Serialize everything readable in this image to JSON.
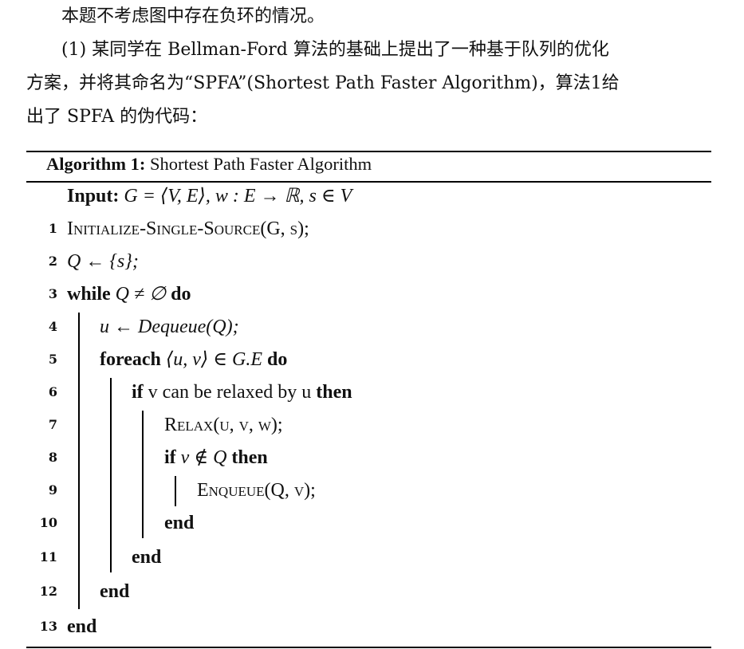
{
  "intro": {
    "line1": "本题不考虑图中存在负环的情况。",
    "line2": "(1) 某同学在 Bellman-Ford 算法的基础上提出了一种基于队列的优化",
    "line3": "方案，并将其命名为“SPFA”(Shortest Path Faster Algorithm)，算法1给",
    "line4": "出了 SPFA 的伪代码："
  },
  "algorithm": {
    "label": "Algorithm 1:",
    "title": "Shortest Path Faster Algorithm",
    "input_label": "Input:",
    "input_value": "G = ⟨V, E⟩, w : E → ℝ, s ∈ V",
    "lines": [
      {
        "no": "1",
        "text": "Initialize-Single-Source(G, s);"
      },
      {
        "no": "2",
        "text": "Q ← {s};"
      },
      {
        "no": "3",
        "kw1": "while",
        "text": " Q ≠ ∅ ",
        "kw2": "do"
      },
      {
        "no": "4",
        "text": "u ← Dequeue(Q);"
      },
      {
        "no": "5",
        "kw1": "foreach",
        "text": " ⟨u, v⟩ ∈ G.E ",
        "kw2": "do"
      },
      {
        "no": "6",
        "kw1": "if",
        "text": " v can be relaxed by u ",
        "kw2": "then"
      },
      {
        "no": "7",
        "text": "Relax(u, v, w);"
      },
      {
        "no": "8",
        "kw1": "if",
        "text": " v ∉ Q ",
        "kw2": "then"
      },
      {
        "no": "9",
        "text": "Enqueue(Q, v);"
      },
      {
        "no": "10",
        "kw1": "end"
      },
      {
        "no": "11",
        "kw1": "end"
      },
      {
        "no": "12",
        "kw1": "end"
      },
      {
        "no": "13",
        "kw1": "end"
      }
    ]
  }
}
